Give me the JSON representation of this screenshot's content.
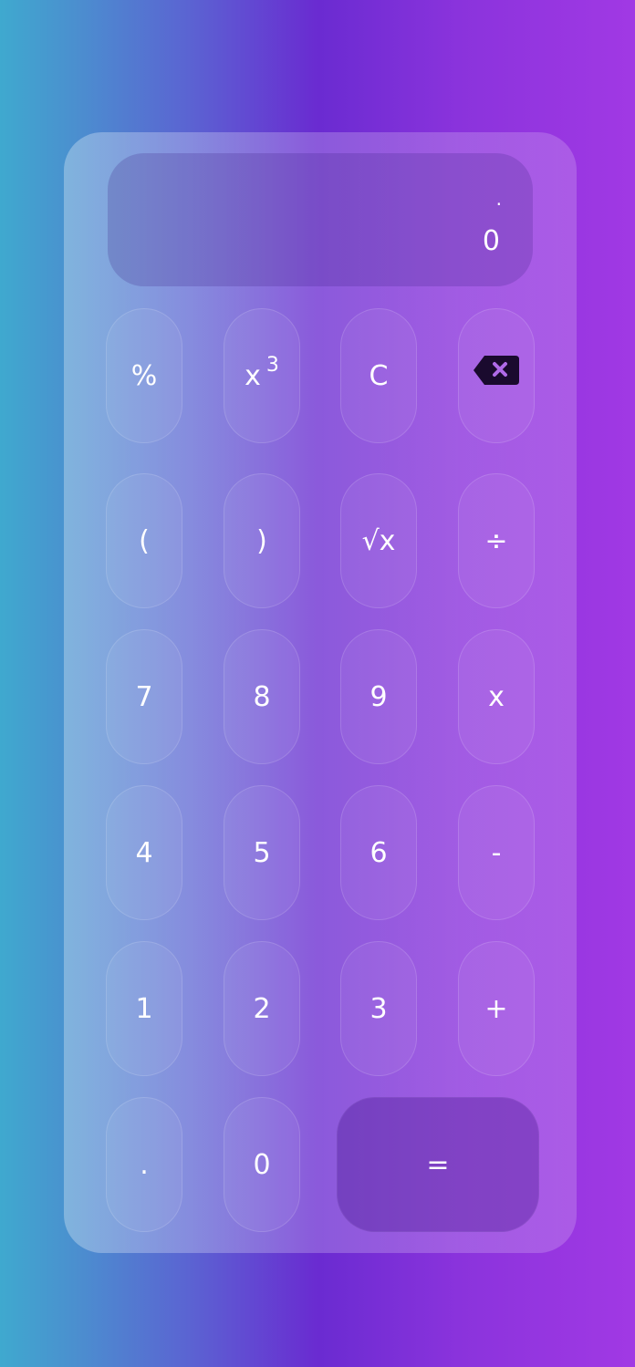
{
  "display": {
    "expression": ".",
    "result": "0"
  },
  "keys": {
    "percent": "%",
    "cube_base": "x",
    "cube_exp": "3",
    "clear": "C",
    "backspace_icon": "backspace-icon",
    "open_paren": "(",
    "close_paren": ")",
    "sqrt": "√x",
    "divide": "÷",
    "seven": "7",
    "eight": "8",
    "nine": "9",
    "multiply": "x",
    "four": "4",
    "five": "5",
    "six": "6",
    "minus": "-",
    "one": "1",
    "two": "2",
    "three": "3",
    "plus": "+",
    "dot": ".",
    "zero": "0",
    "equals": "="
  },
  "colors": {
    "gradient_left": "#3fa9cf",
    "gradient_mid": "#6a2bd1",
    "gradient_right": "#a139e4",
    "backspace_icon_fill": "#1a0a2e",
    "backspace_icon_x": "#b06ae8"
  }
}
